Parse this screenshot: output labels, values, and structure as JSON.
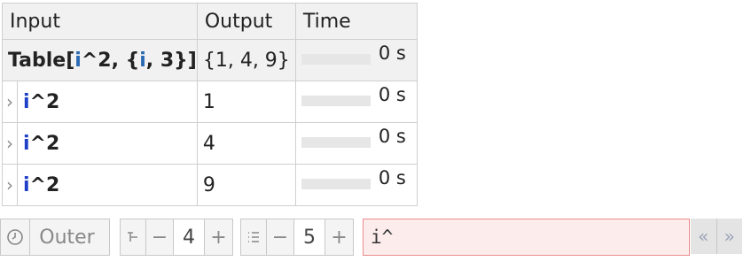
{
  "table": {
    "headers": {
      "input": "Input",
      "output": "Output",
      "time": "Time"
    },
    "top": {
      "input_parts": [
        "Table[",
        "i",
        "^2, {",
        "i",
        ", 3}]"
      ],
      "output": "{1, 4, 9}",
      "time": "0 s"
    },
    "rows": [
      {
        "var": "i",
        "expr": "^2",
        "output": "1",
        "time": "0 s"
      },
      {
        "var": "i",
        "expr": "^2",
        "output": "4",
        "time": "0 s"
      },
      {
        "var": "i",
        "expr": "^2",
        "output": "9",
        "time": "0 s"
      }
    ],
    "chevron": "›"
  },
  "toolbar": {
    "outer_icon": "clock-icon",
    "outer_label": "Outer",
    "depth": {
      "icon": "depth-icon",
      "minus": "−",
      "value": "4",
      "plus": "+"
    },
    "items": {
      "icon": "list-icon",
      "minus": "−",
      "value": "5",
      "plus": "+"
    },
    "search_value": "i^",
    "prev": "«",
    "next": "»"
  }
}
